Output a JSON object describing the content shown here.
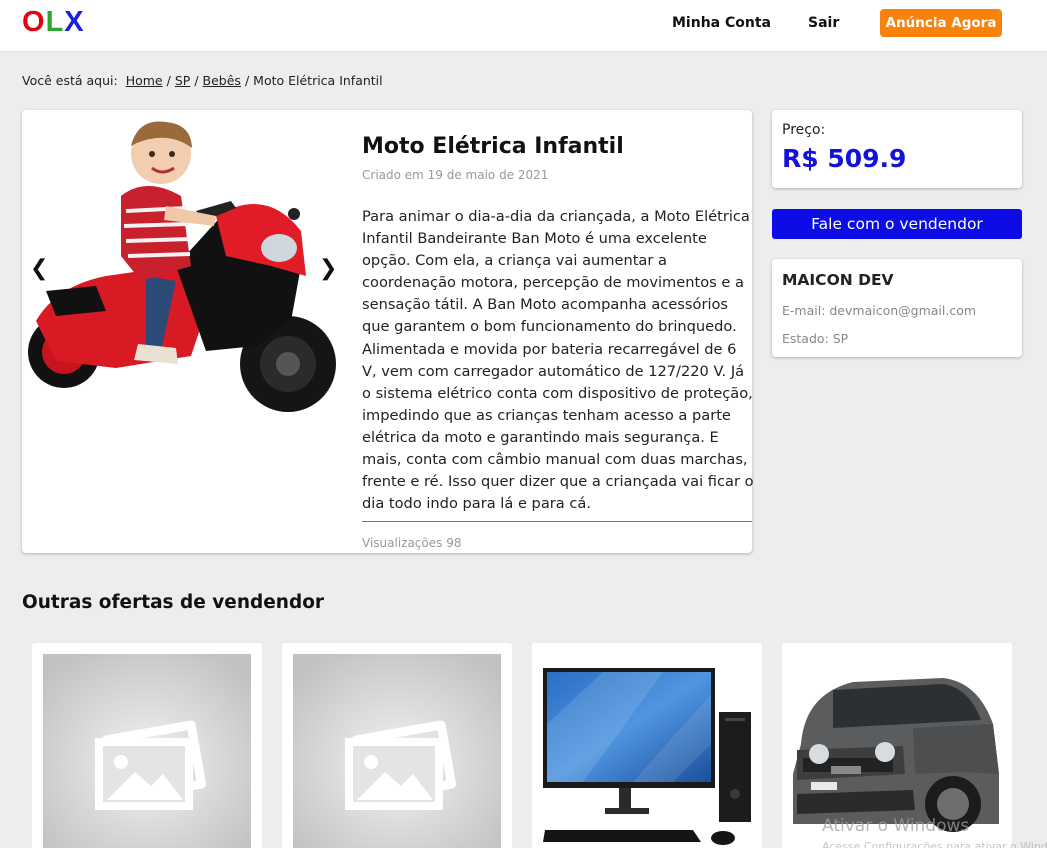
{
  "header": {
    "logo": [
      "O",
      "L",
      "X"
    ],
    "nav": {
      "account": "Minha Conta",
      "logout": "Sair"
    },
    "cta": "Anúncia Agora",
    "logo_colors": [
      "#e8000f",
      "#2ba82b",
      "#1a1ee0"
    ],
    "cta_color": "#f7820c"
  },
  "breadcrumb": {
    "prefix": "Você está aqui:",
    "items": [
      "Home",
      "SP",
      "Bebês"
    ],
    "current": "Moto Elétrica Infantil"
  },
  "product": {
    "image_icon": "toy-motorcycle-photo",
    "prev_icon": "chevron-left-icon",
    "next_icon": "chevron-right-icon",
    "title": "Moto Elétrica Infantil",
    "created": "Criado em 19 de maio de 2021",
    "description": "Para animar o dia-a-dia da criançada, a Moto Elétrica Infantil Bandeirante Ban Moto é uma excelente opção. Com ela, a criança vai aumentar a coordenação motora, percepção de movimentos e a sensação tátil. A Ban Moto acompanha acessórios que garantem o bom funcionamento do brinquedo. Alimentada e movida por bateria recarregável de 6 V, vem com carregador automático de 127/220 V. Já o sistema elétrico conta com dispositivo de proteção, impedindo que as crianças tenham acesso a parte elétrica da moto e garantindo mais segurança. E mais, conta com câmbio manual com duas marchas, frente e ré. Isso quer dizer que a criançada vai ficar o dia todo indo para lá e para cá.",
    "views": "Visualizações 98"
  },
  "price": {
    "label": "Preço:",
    "value": "R$ 509.9",
    "color": "#1212d8"
  },
  "contact_button": {
    "label": "Fale com o vendendor",
    "color": "#0c0ce6"
  },
  "seller": {
    "name": "MAICON DEV",
    "email": "E-mail: devmaicon@gmail.com",
    "state": "Estado: SP"
  },
  "other_offers": {
    "title": "Outras ofertas de vendendor",
    "items": [
      {
        "image": "placeholder-image-icon"
      },
      {
        "image": "placeholder-image-icon"
      },
      {
        "image": "desktop-computer-photo"
      },
      {
        "image": "car-photo"
      }
    ]
  },
  "os_overlay": {
    "watermark": "Ativar o Windows",
    "watermark_sub": "Acesse Configurações para ativar o Windows."
  }
}
